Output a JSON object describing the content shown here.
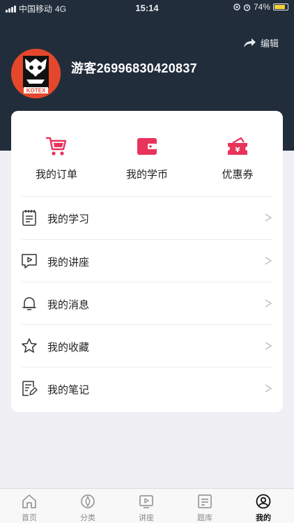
{
  "status_bar": {
    "carrier": "中国移动",
    "network": "4G",
    "time": "15:14",
    "battery_percent": "74%",
    "battery_level": 0.74
  },
  "header": {
    "edit_label": "编辑",
    "username": "游客26996830420837",
    "avatar_text": "KOTEX"
  },
  "quick_actions": [
    {
      "label": "我的订单",
      "icon": "shopping-cart-icon"
    },
    {
      "label": "我的学币",
      "icon": "wallet-icon"
    },
    {
      "label": "优惠券",
      "icon": "coupon-icon"
    }
  ],
  "menu": [
    {
      "label": "我的学习",
      "icon": "notebook-icon"
    },
    {
      "label": "我的讲座",
      "icon": "video-chat-icon"
    },
    {
      "label": "我的消息",
      "icon": "bell-icon"
    },
    {
      "label": "我的收藏",
      "icon": "star-icon"
    },
    {
      "label": "我的笔记",
      "icon": "note-edit-icon"
    }
  ],
  "tabbar": [
    {
      "label": "首页",
      "icon": "home-icon"
    },
    {
      "label": "分类",
      "icon": "compass-icon"
    },
    {
      "label": "讲座",
      "icon": "play-screen-icon"
    },
    {
      "label": "题库",
      "icon": "document-icon"
    },
    {
      "label": "我的",
      "icon": "user-circle-icon",
      "active": true
    }
  ],
  "colors": {
    "header_bg": "#222d3b",
    "accent": "#e8335a",
    "page_bg": "#efeff4"
  }
}
